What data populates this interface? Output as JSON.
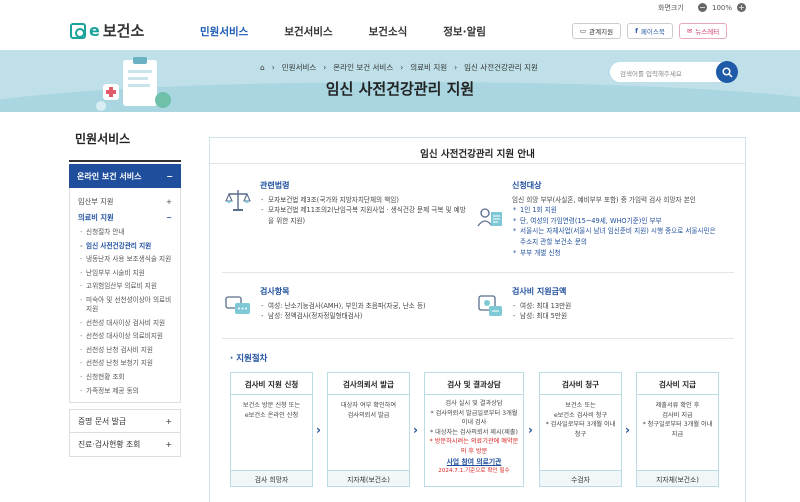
{
  "topbar": {
    "zoom_label": "화면크기",
    "minus": "−",
    "zoom": "100%",
    "plus": "+"
  },
  "header": {
    "logo": {
      "e": "e",
      "text": "보건소"
    },
    "nav": [
      "민원서비스",
      "보건서비스",
      "보건소식",
      "정보·알림"
    ],
    "buttons": {
      "related": "관계지원",
      "facebook": "페이스북",
      "newsletter": "뉴스레터"
    }
  },
  "banner": {
    "breadcrumb": [
      "민원서비스",
      "온라인 보건 서비스",
      "의료비 지원",
      "임신 사전건강관리 지원"
    ],
    "title": "임신 사전건강관리 지원",
    "search_placeholder": "검색어를 입력해주세요"
  },
  "lnb": {
    "title": "민원서비스",
    "current": "온라인 보건 서비스",
    "minus": "−",
    "items": [
      {
        "label": "임산부 지원",
        "level": 2,
        "active": false
      },
      {
        "label": "의료비 지원",
        "level": 2,
        "active": true
      },
      {
        "label": "신청절차 안내",
        "level": 3,
        "active": false
      },
      {
        "label": "임신 사전건강관리 지원",
        "level": 3,
        "active": true
      },
      {
        "label": "냉동난자 사용 보조생식술 지원",
        "level": 3,
        "active": false
      },
      {
        "label": "난임부부 시술비 지원",
        "level": 3,
        "active": false
      },
      {
        "label": "고위험임산부 의료비 지원",
        "level": 3,
        "active": false
      },
      {
        "label": "미숙아 및 선천성이상아 의료비 지원",
        "level": 3,
        "active": false
      },
      {
        "label": "선천성 대사이상 검사비 지원",
        "level": 3,
        "active": false
      },
      {
        "label": "선천성 대사이상 의료비지원",
        "level": 3,
        "active": false
      },
      {
        "label": "선천성 난청 검사비 지원",
        "level": 3,
        "active": false
      },
      {
        "label": "선천성 난청 보청기 지원",
        "level": 3,
        "active": false
      },
      {
        "label": "신청현황 조회",
        "level": 3,
        "active": false
      },
      {
        "label": "가족정보 제공 동의",
        "level": 3,
        "active": false
      }
    ],
    "others": [
      "증명 문서 발급",
      "진료·검사현황 조회"
    ],
    "plus": "+"
  },
  "main": {
    "title": "임신 사전건강관리 지원 안내",
    "law": {
      "title": "관련법령",
      "items": [
        "모자보건법 제3조(국가와 지방자치단체의 책임)",
        "모자보건법 제11조의2(난임극복 지원사업 · 생식건강 문제 극복 및 예방을 위한 지원)"
      ]
    },
    "target": {
      "title": "신청대상",
      "intro": "임신 희망 부부(사실혼, 예비부부 포함) 중 가임력 검사 희망자 본인",
      "items": [
        "1인 1회 지원",
        "단, 여성의 가임연령(15~49세, WHO기준)인 부부",
        "서울시는 자체사업(서울시 남녀 임신준비 지원) 시행 중으로 서울시민은 주소지 관할 보건소 문의",
        "부부 개별 신청"
      ]
    },
    "items": {
      "title": "검사항목",
      "items": [
        "여성: 난소기능검사(AMH), 부인과 초음파(자궁, 난소 등)",
        "남성: 정액검사(정자정밀형태검사)"
      ]
    },
    "amount": {
      "title": "검사비 지원금액",
      "items": [
        "여성: 최대 13만원",
        "남성: 최대 5만원"
      ]
    },
    "process_title": "· 지원절차",
    "arrow": "›",
    "steps": [
      {
        "title": "검사비 지원 신청",
        "body": [
          "보건소 방문 신청 또는",
          "e보건소 온라인 신청"
        ],
        "footer": "검사 희망자"
      },
      {
        "title": "검사의뢰서 발급",
        "body": [
          "대상자 여부 확인하여",
          "검사의뢰서 발급"
        ],
        "footer": "지자체(보건소)"
      },
      {
        "title": "검사 및 결과상담",
        "body": [
          "검사 실시 및 결과상담",
          "* 검사의뢰서 발급일로부터 3개월 이내 검사",
          "* 대상자는 검사의뢰서 제시(제출)"
        ],
        "red": "* 방문하시려는 의료기관에 예약문의 후 방문",
        "link": "사업 참여 의료기관",
        "note": "2024.7.1.기준으로 확인 필수",
        "footer": ""
      },
      {
        "title": "검사비 청구",
        "body": [
          "보건소 또는",
          "e보건소 검사비 청구",
          "* 검사일로부터 3개월 이내 청구"
        ],
        "footer": "수검자"
      },
      {
        "title": "검사비 지급",
        "body": [
          "제출서류 확인 후",
          "검사비 지급",
          "* 청구일로부터 3개월 이내 지급"
        ],
        "footer": "지자체(보건소)"
      }
    ]
  }
}
